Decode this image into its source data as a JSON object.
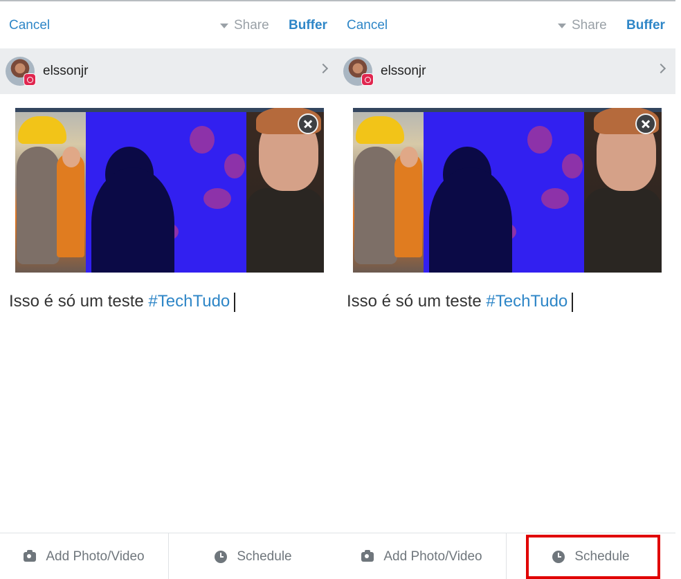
{
  "header": {
    "cancel_label": "Cancel",
    "share_label": "Share",
    "buffer_label": "Buffer"
  },
  "profile": {
    "username": "elssonjr",
    "network": "instagram-icon"
  },
  "post": {
    "caption_text": "Isso é só um teste ",
    "hashtag": "#TechTudo"
  },
  "bottom_bar": {
    "add_media_label": "Add Photo/Video",
    "schedule_label": "Schedule"
  },
  "colors": {
    "accent": "#2e86c7",
    "highlight_box": "#e00000",
    "instagram": "#e0264f"
  }
}
